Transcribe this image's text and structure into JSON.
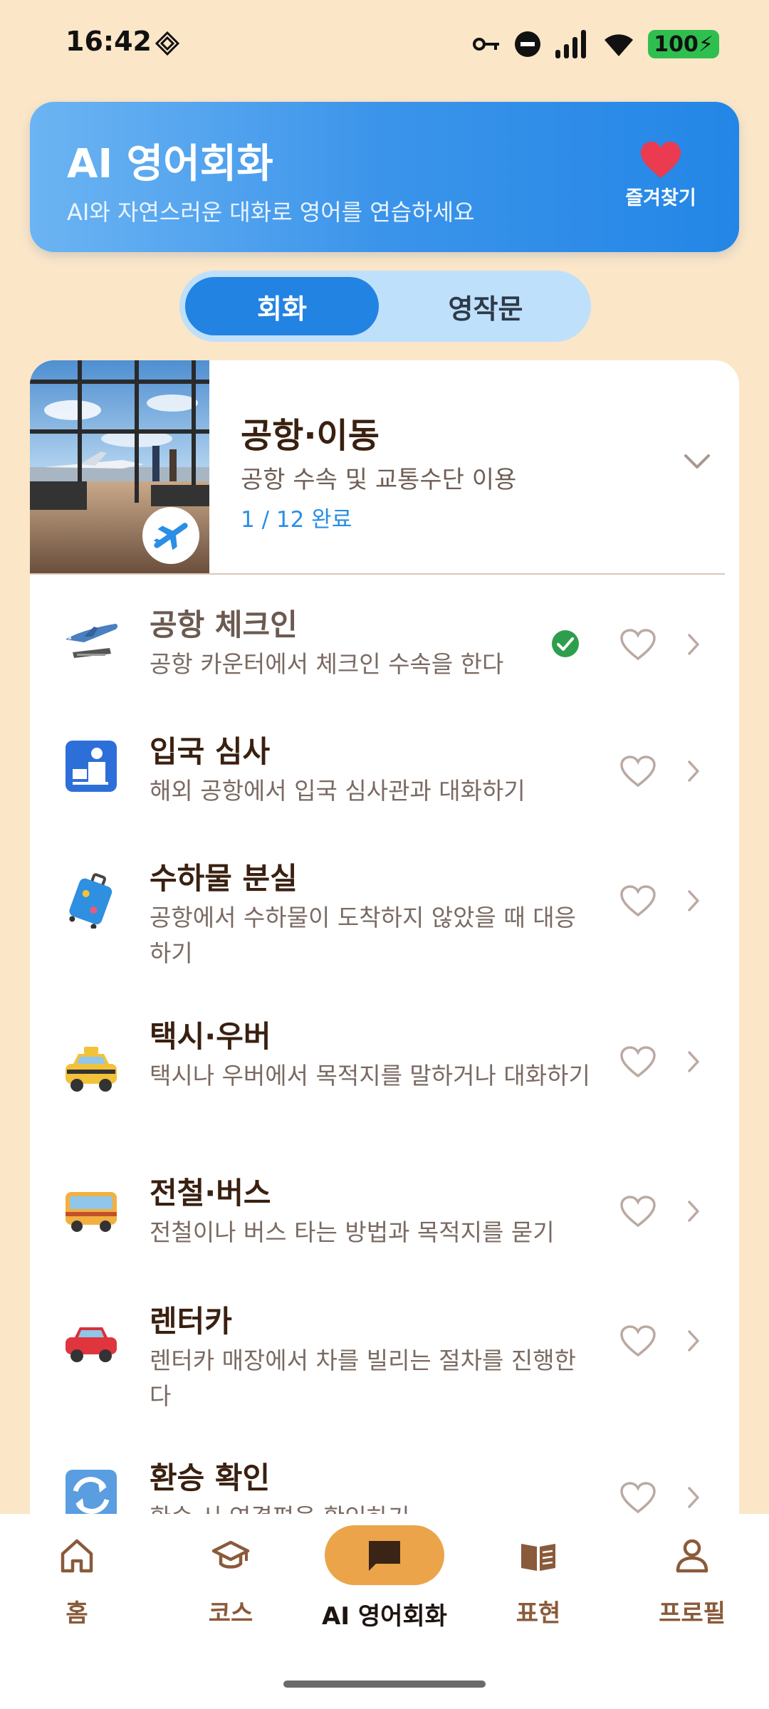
{
  "status_bar": {
    "time": "16:42",
    "battery": "100"
  },
  "header": {
    "title": "AI 영어회화",
    "subtitle": "AI와 자연스러운 대화로 영어를 연습하세요",
    "favorites_label": "즐겨찾기"
  },
  "tabs": {
    "active": "회화",
    "inactive": "영작문"
  },
  "category": {
    "title": "공항·이동",
    "subtitle": "공항 수속 및 교통수단 이용",
    "progress": "1 / 12 완료"
  },
  "items": [
    {
      "title": "공항 체크인",
      "desc": "공항 카운터에서 체크인 수속을 한다",
      "icon": "airplane-departure-icon",
      "completed": true
    },
    {
      "title": "입국 심사",
      "desc": "해외 공항에서 입국 심사관과 대화하기",
      "icon": "passport-control-icon",
      "completed": false
    },
    {
      "title": "수하물 분실",
      "desc": "공항에서 수하물이 도착하지 않았을 때 대응하기",
      "icon": "luggage-icon",
      "completed": false
    },
    {
      "title": "택시·우버",
      "desc": "택시나 우버에서 목적지를 말하거나 대화하기",
      "icon": "taxi-icon",
      "completed": false
    },
    {
      "title": "전철·버스",
      "desc": "전철이나 버스 타는 방법과 목적지를 묻기",
      "icon": "bus-icon",
      "completed": false
    },
    {
      "title": "렌터카",
      "desc": "렌터카 매장에서 차를 빌리는 절차를 진행한다",
      "icon": "car-icon",
      "completed": false
    },
    {
      "title": "환승 확인",
      "desc": "환승 시 연결편을 확인하기",
      "icon": "transfer-arrows-icon",
      "completed": false
    }
  ],
  "nav": [
    {
      "label": "홈",
      "icon": "home-icon"
    },
    {
      "label": "코스",
      "icon": "graduation-cap-icon"
    },
    {
      "label": "AI 영어회화",
      "icon": "chat-bubble-icon",
      "active": true
    },
    {
      "label": "표현",
      "icon": "book-icon"
    },
    {
      "label": "프로필",
      "icon": "profile-icon"
    }
  ],
  "colors": {
    "accent_blue": "#2383e2",
    "nav_active": "#eca44a",
    "background": "#fbe6c8",
    "check_green": "#2e9e4e"
  }
}
